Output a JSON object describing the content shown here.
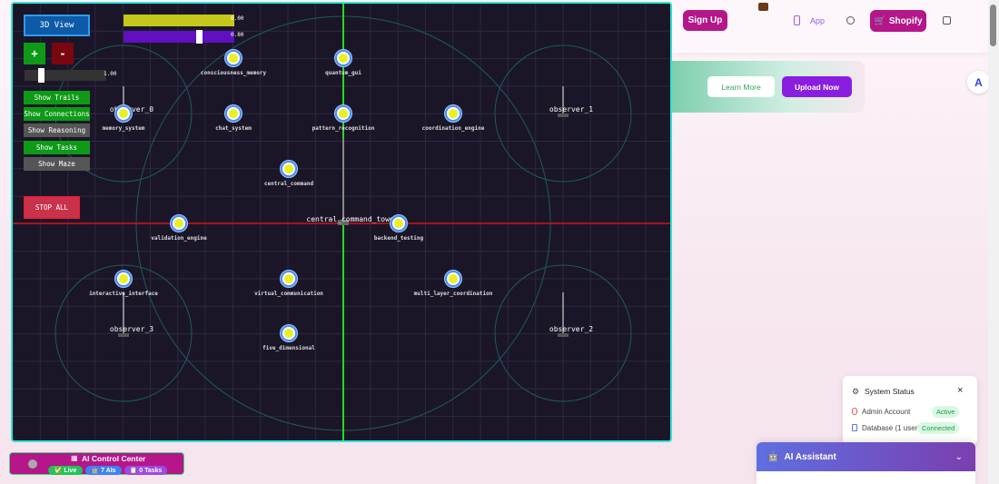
{
  "scene": {
    "view_button": "3D View",
    "zoom_in": "+",
    "zoom_out": "-",
    "slider1_value": "0.00",
    "slider2_value": "0.80",
    "slider2_level": 0.8,
    "zoom_value": "1.00",
    "zoom_level": 0.2,
    "toggles": [
      {
        "label": "Show Trails",
        "on": true
      },
      {
        "label": "Show Connections",
        "on": true
      },
      {
        "label": "Show Reasoning",
        "on": false
      },
      {
        "label": "Show Tasks",
        "on": true
      },
      {
        "label": "Show Maze",
        "on": false
      }
    ],
    "stop_button": "STOP ALL",
    "tower_label": "central_command_tower",
    "nodes": [
      "memory_system",
      "consciousness_memory",
      "quantum_gui",
      "chat_system",
      "pattern_recognition",
      "coordination_engine",
      "central_command",
      "validation_engine",
      "backend_testing",
      "interactive_interface",
      "virtual_communication",
      "multi_layer_coordination",
      "five_dimensional"
    ],
    "observers": [
      "observer_0",
      "observer_1",
      "observer_2",
      "observer_3"
    ],
    "colors": {
      "grid": "#2c2842",
      "axis_x": "#d0101a",
      "axis_y": "#22dd22",
      "node_outer": "#4a8ee8",
      "node_inner": "#e8f020",
      "ring": "#1f5a5e"
    }
  },
  "header": {
    "sign_up": "Sign Up",
    "app": "App",
    "shopify": "Shopify"
  },
  "banner": {
    "learn_more": "Learn More",
    "upload_now": "Upload Now"
  },
  "status": {
    "title": "System Status",
    "rows": [
      {
        "label": "Admin Account",
        "badge": "Active"
      },
      {
        "label": "Database (1 users)",
        "badge": "Connected"
      }
    ]
  },
  "assistant": {
    "title": "AI Assistant"
  },
  "control_center": {
    "title": "AI Control Center",
    "live": "Live",
    "ais": "7 AIs",
    "tasks": "0 Tasks"
  }
}
